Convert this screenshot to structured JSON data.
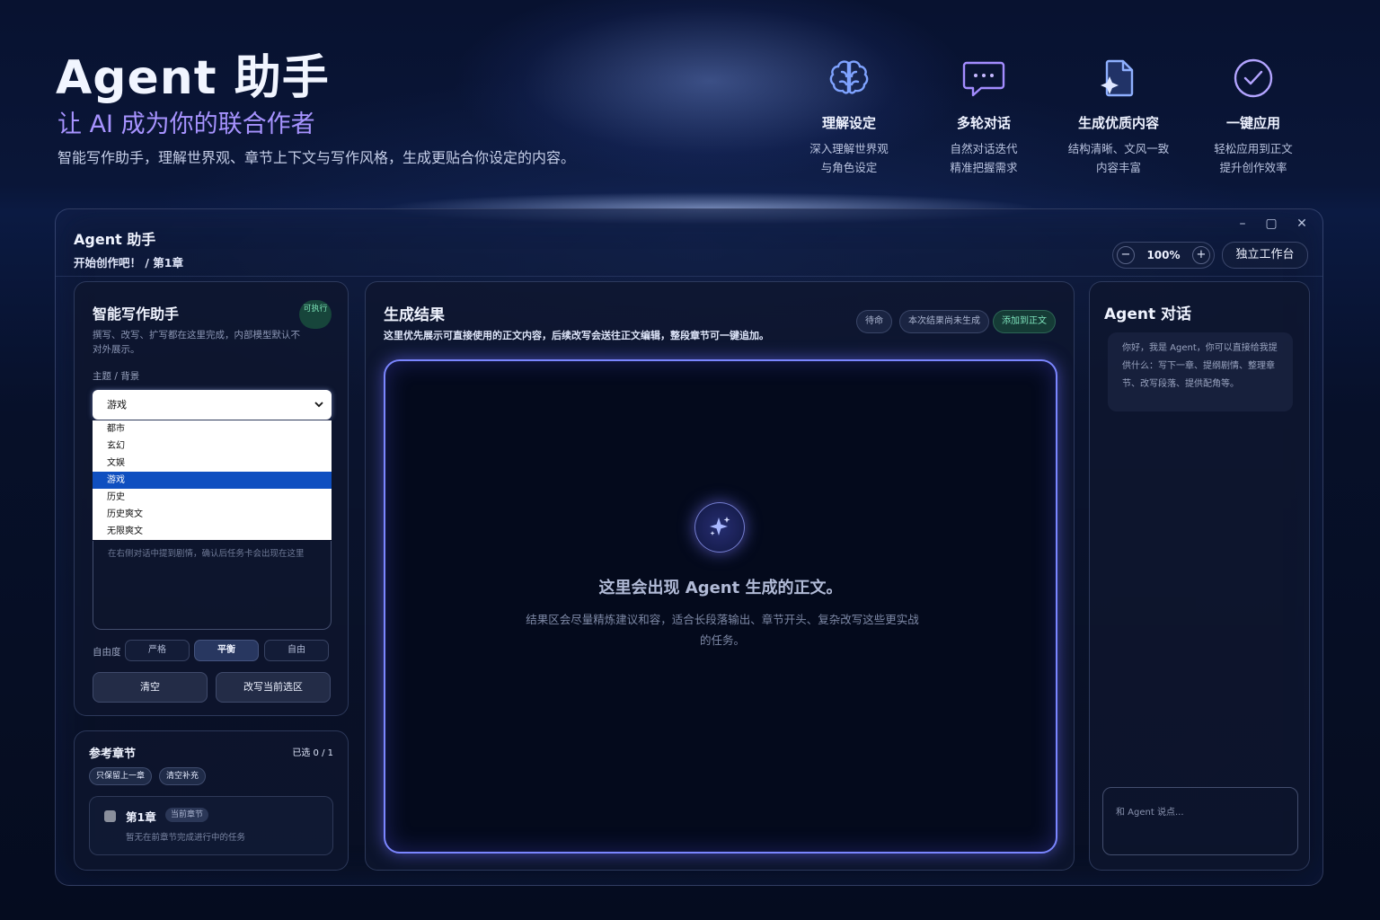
{
  "hero": {
    "title": "Agent 助手",
    "subtitle": "让 AI 成为你的联合作者",
    "description": "智能写作助手，理解世界观、章节上下文与写作风格，生成更贴合你设定的内容。"
  },
  "features": [
    {
      "icon": "brain-icon",
      "title": "理解设定",
      "line1": "深入理解世界观",
      "line2": "与角色设定"
    },
    {
      "icon": "chat-bubble-icon",
      "title": "多轮对话",
      "line1": "自然对话迭代",
      "line2": "精准把握需求"
    },
    {
      "icon": "sparkle-document-icon",
      "title": "生成优质内容",
      "line1": "结构清晰、文风一致",
      "line2": "内容丰富"
    },
    {
      "icon": "check-circle-icon",
      "title": "一键应用",
      "line1": "轻松应用到正文",
      "line2": "提升创作效率"
    }
  ],
  "window": {
    "title": "Agent 助手",
    "breadcrumb": "开始创作吧！ / 第1章",
    "controls": {
      "minimize": "–",
      "maximize": "▢",
      "close": "✕"
    },
    "zoom": {
      "minus": "−",
      "value": "100%",
      "plus": "+"
    },
    "standalone_label": "独立工作台"
  },
  "assistant": {
    "title": "智能写作助手",
    "badge": "可执行",
    "description": "撰写、改写、扩写都在这里完成，内部模型默认不对外展示。",
    "topic_label": "主题 / 背景",
    "selected": "游戏",
    "options": [
      "都市",
      "玄幻",
      "文娱",
      "游戏",
      "历史",
      "历史爽文",
      "无限爽文"
    ],
    "textarea_placeholder": "在右侧对话中提到剧情，确认后任务卡会出现在这里",
    "freedom_label": "自由度",
    "freedom_options": [
      "严格",
      "平衡",
      "自由"
    ],
    "freedom_selected": "平衡",
    "clear_label": "清空",
    "rewrite_label": "改写当前选区"
  },
  "reference": {
    "title": "参考章节",
    "count": "已选 0 / 1",
    "chip_keep_prev": "只保留上一章",
    "chip_clear_extra": "清空补充",
    "chapter_name": "第1章",
    "chapter_tag": "当前章节",
    "chapter_desc": "暂无在前章节完成进行中的任务"
  },
  "result": {
    "title": "生成结果",
    "description": "这里优先展示可直接使用的正文内容，后续改写会送往正文编辑，整段章节可一键追加。",
    "tag_pending": "待命",
    "tag_status": "本次结果尚未生成",
    "tag_add": "添加到正文",
    "empty_title": "这里会出现 Agent 生成的正文。",
    "empty_desc": "结果区会尽量精炼建议和容，适合长段落输出、章节开头、复杂改写这些更实战的任务。"
  },
  "chat": {
    "title": "Agent 对话",
    "greeting": "你好，我是 Agent，你可以直接给我提供什么：写下一章、提纲剧情、整理章节、改写段落、提供配角等。",
    "input_placeholder": "和 Agent 说点..."
  },
  "colors": {
    "accent": "#7b86ff",
    "highlight": "#0f4fc0",
    "success": "#7ee4bd"
  }
}
